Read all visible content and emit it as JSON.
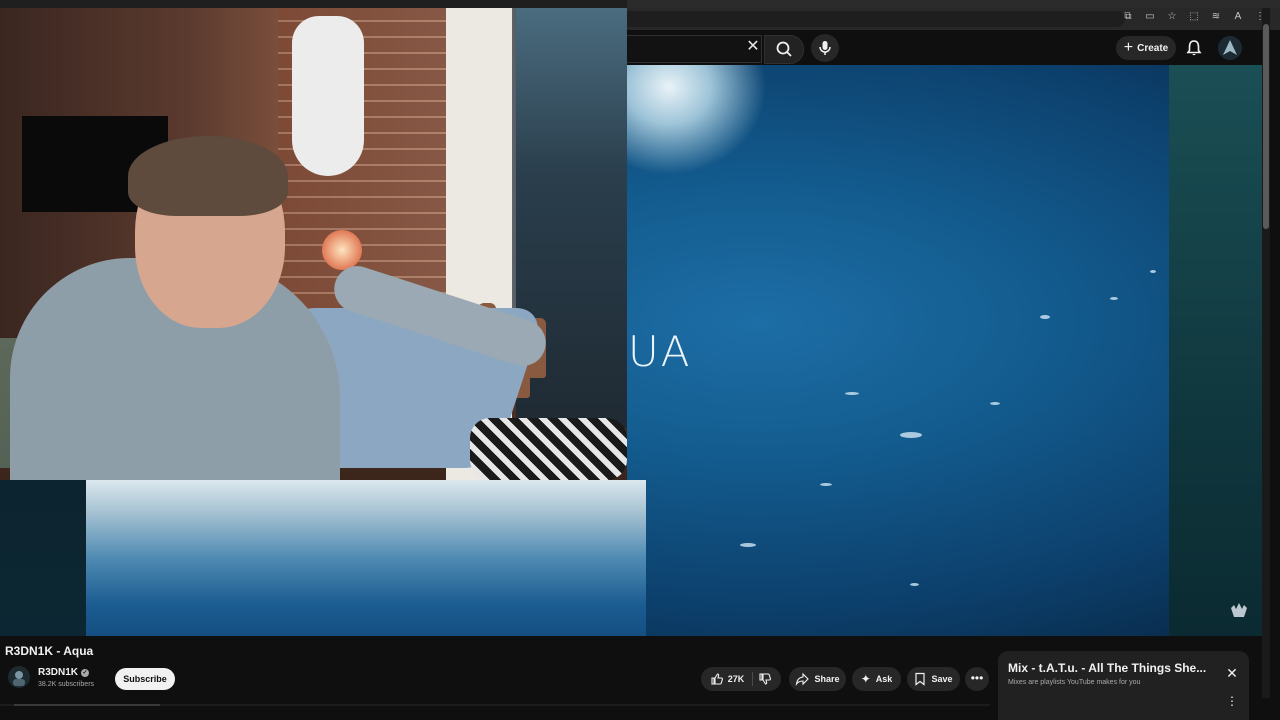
{
  "toolbar": {
    "create_label": "Create",
    "extension_icons": [
      "external-link-icon",
      "cast-icon",
      "star-icon",
      "extensions-icon",
      "translate-icon",
      "profile-icon",
      "kebab-menu-icon"
    ]
  },
  "search": {
    "clear_symbol": "✕"
  },
  "video": {
    "overlay_text": "UA"
  },
  "info": {
    "title": "R3DN1K - Aqua",
    "channel_name": "R3DN1K",
    "subscribers": "38.2K subscribers",
    "subscribe_label": "Subscribe",
    "likes": "27K",
    "share_label": "Share",
    "ask_label": "Ask",
    "save_label": "Save",
    "more_symbol": "•••"
  },
  "mix": {
    "title": "Mix - t.A.T.u. - All The Things She...",
    "subtitle": "Mixes are playlists YouTube makes for you",
    "close_symbol": "✕",
    "more_symbol": "⋮"
  },
  "colors": {
    "page_bg": "#0f0f0f",
    "pill_bg": "#272727",
    "subscribe_bg": "#f1f1f1",
    "ocean": "#135c8f"
  }
}
